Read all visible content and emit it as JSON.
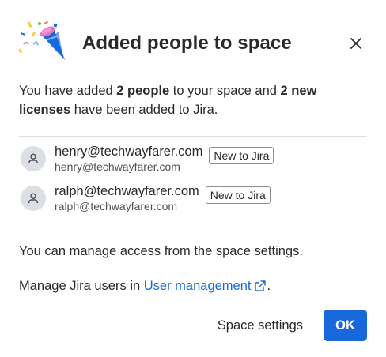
{
  "dialog": {
    "title": "Added people to space",
    "close_icon": "close-icon",
    "illustration": "party-popper-illustration"
  },
  "intro": {
    "part1": "You have added ",
    "people_count": "2 people",
    "part2": " to your space and ",
    "licenses": "2 new licenses",
    "part3": " have been added to Jira."
  },
  "users": [
    {
      "email": "henry@techwayfarer.com",
      "subtitle": "henry@techwayfarer.com",
      "badge": "New to Jira",
      "avatar_icon": "person-icon"
    },
    {
      "email": "ralph@techwayfarer.com",
      "subtitle": "ralph@techwayfarer.com",
      "badge": "New to Jira",
      "avatar_icon": "person-icon"
    }
  ],
  "manage_access_text": "You can manage access from the space settings.",
  "manage_users": {
    "prefix": "Manage Jira users in ",
    "link_label": "User management",
    "link_icon": "external-link-icon",
    "suffix": "."
  },
  "footer": {
    "secondary_label": "Space settings",
    "primary_label": "OK"
  },
  "colors": {
    "primary": "#1868db",
    "text": "#292a2e",
    "subtle_text": "#505258",
    "divider": "#dddee1",
    "avatar_bg": "#dcdfe4"
  }
}
